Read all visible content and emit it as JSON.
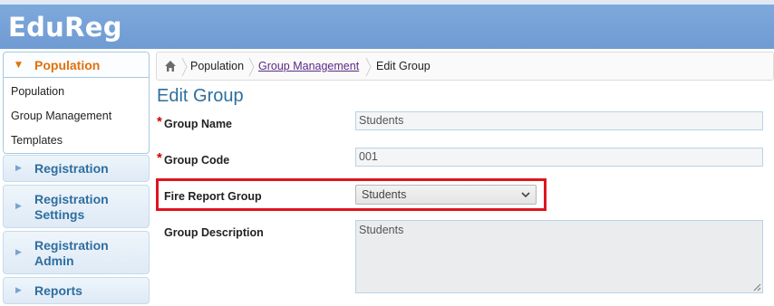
{
  "app": {
    "title": "EduReg"
  },
  "sidebar": {
    "open_section": {
      "label": "Population",
      "items": [
        {
          "label": "Population"
        },
        {
          "label": "Group Management"
        },
        {
          "label": "Templates"
        }
      ]
    },
    "sections": [
      {
        "label": "Registration"
      },
      {
        "label": "Registration Settings"
      },
      {
        "label": "Registration Admin"
      },
      {
        "label": "Reports"
      }
    ],
    "colors": {
      "active": "#e17009",
      "header_text": "#2e6e9e"
    }
  },
  "breadcrumb": {
    "home_icon": "home-icon",
    "items": [
      {
        "label": "Population"
      },
      {
        "label": "Group Management"
      },
      {
        "label": "Edit Group"
      }
    ]
  },
  "form": {
    "title": "Edit Group",
    "required_marker": "*",
    "group_name": {
      "label": "Group Name",
      "value": "Students"
    },
    "group_code": {
      "label": "Group Code",
      "value": "001"
    },
    "fire_report_group": {
      "label": "Fire Report Group",
      "selected": "Students"
    },
    "group_description": {
      "label": "Group Description",
      "value": "Students"
    },
    "highlight_color": "#e0141e"
  }
}
